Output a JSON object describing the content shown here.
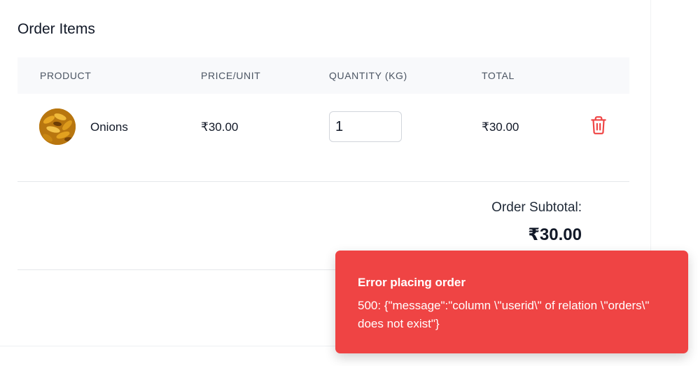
{
  "section": {
    "title": "Order Items"
  },
  "table": {
    "headers": [
      "PRODUCT",
      "PRICE/UNIT",
      "QUANTITY (KG)",
      "TOTAL"
    ],
    "rows": [
      {
        "product": "Onions",
        "price": "₹30.00",
        "quantity": "1",
        "total": "₹30.00",
        "delete_icon": "trash-icon"
      }
    ]
  },
  "summary": {
    "label": "Order Subtotal:",
    "value": "₹30.00"
  },
  "toast": {
    "title": "Error placing order",
    "message": "500: {\"message\":\"column \\\"userid\\\" of relation \\\"orders\\\" does not exist\"}",
    "color": "#ef4444"
  },
  "colors": {
    "delete": "#ef4444",
    "header_bg": "#f8f9fb"
  }
}
